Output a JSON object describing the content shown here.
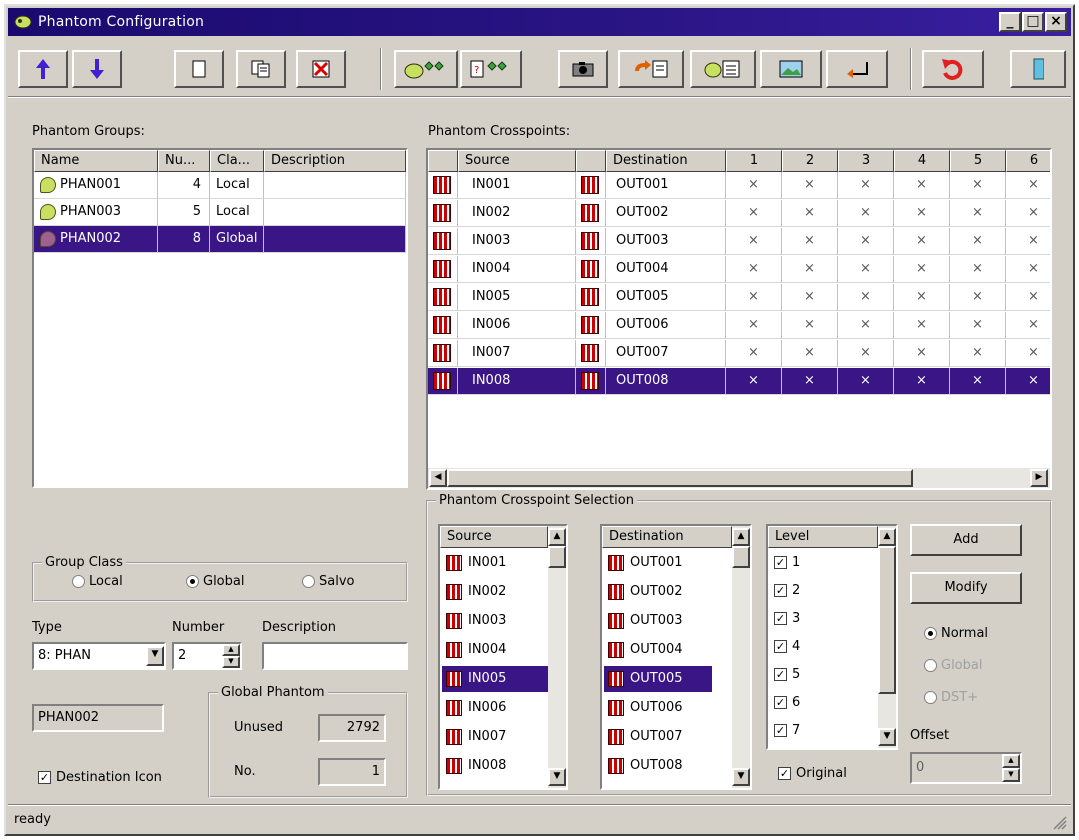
{
  "window": {
    "title": "Phantom Configuration"
  },
  "toolbar": {
    "icons": [
      "arrow-up-icon",
      "arrow-down-icon",
      "new-document-icon",
      "copy-icon",
      "delete-icon",
      "phantom-add-icon",
      "phantom-edit-icon",
      "camera-icon",
      "restore-icon",
      "group-list-icon",
      "picture-icon",
      "return-icon",
      "undo-icon",
      "exit-icon"
    ]
  },
  "groups": {
    "label": "Phantom Groups:",
    "columns": [
      "Name",
      "Nu...",
      "Cla...",
      "Description"
    ],
    "rows": [
      {
        "name": "PHAN001",
        "num": "4",
        "cls": "Local",
        "desc": ""
      },
      {
        "name": "PHAN003",
        "num": "5",
        "cls": "Local",
        "desc": ""
      },
      {
        "name": "PHAN002",
        "num": "8",
        "cls": "Global",
        "desc": ""
      }
    ]
  },
  "crosspoints": {
    "label": "Phantom Crosspoints:",
    "columns": [
      "",
      "Source",
      "",
      "Destination",
      "1",
      "2",
      "3",
      "4",
      "5",
      "6"
    ],
    "rows": [
      {
        "src": "IN001",
        "dst": "OUT001",
        "marks": [
          "×",
          "×",
          "×",
          "×",
          "×",
          "×"
        ]
      },
      {
        "src": "IN002",
        "dst": "OUT002",
        "marks": [
          "×",
          "×",
          "×",
          "×",
          "×",
          "×"
        ]
      },
      {
        "src": "IN003",
        "dst": "OUT003",
        "marks": [
          "×",
          "×",
          "×",
          "×",
          "×",
          "×"
        ]
      },
      {
        "src": "IN004",
        "dst": "OUT004",
        "marks": [
          "×",
          "×",
          "×",
          "×",
          "×",
          "×"
        ]
      },
      {
        "src": "IN005",
        "dst": "OUT005",
        "marks": [
          "×",
          "×",
          "×",
          "×",
          "×",
          "×"
        ]
      },
      {
        "src": "IN006",
        "dst": "OUT006",
        "marks": [
          "×",
          "×",
          "×",
          "×",
          "×",
          "×"
        ]
      },
      {
        "src": "IN007",
        "dst": "OUT007",
        "marks": [
          "×",
          "×",
          "×",
          "×",
          "×",
          "×"
        ]
      },
      {
        "src": "IN008",
        "dst": "OUT008",
        "marks": [
          "×",
          "×",
          "×",
          "×",
          "×",
          "×"
        ]
      }
    ]
  },
  "group_class": {
    "label": "Group Class",
    "options": [
      "Local",
      "Global",
      "Salvo"
    ],
    "selected": "Global"
  },
  "type": {
    "label": "Type",
    "value": "8: PHAN"
  },
  "number": {
    "label": "Number",
    "value": "2"
  },
  "description": {
    "label": "Description",
    "value": ""
  },
  "name_field": {
    "value": "PHAN002"
  },
  "global_phantom": {
    "label": "Global Phantom",
    "unused_label": "Unused",
    "unused_value": "2792",
    "no_label": "No.",
    "no_value": "1"
  },
  "destination_icon": {
    "label": "Destination Icon",
    "checked": true
  },
  "selection": {
    "label": "Phantom Crosspoint Selection",
    "source_header": "Source",
    "dest_header": "Destination",
    "level_header": "Level",
    "sources": [
      "IN001",
      "IN002",
      "IN003",
      "IN004",
      "IN005",
      "IN006",
      "IN007",
      "IN008"
    ],
    "destinations": [
      "OUT001",
      "OUT002",
      "OUT003",
      "OUT004",
      "OUT005",
      "OUT006",
      "OUT007",
      "OUT008"
    ],
    "levels": [
      "1",
      "2",
      "3",
      "4",
      "5",
      "6",
      "7"
    ],
    "original_label": "Original",
    "add_label": "Add",
    "modify_label": "Modify",
    "modes": [
      "Normal",
      "Global",
      "DST+"
    ],
    "offset_label": "Offset",
    "offset_value": "0"
  },
  "status": {
    "text": "ready"
  }
}
